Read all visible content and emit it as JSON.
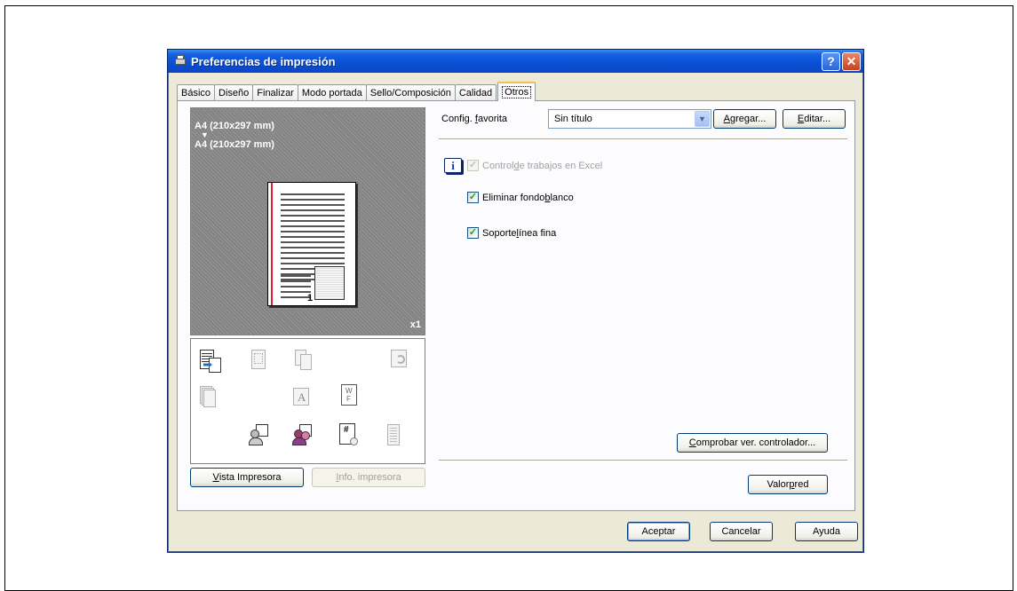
{
  "window": {
    "title": "Preferencias de impresión",
    "help_glyph": "?",
    "close_glyph": "✕"
  },
  "tabs": [
    {
      "label": "Básico"
    },
    {
      "label": "Diseño"
    },
    {
      "label": "Finalizar"
    },
    {
      "label": "Modo portada"
    },
    {
      "label": "Sello/Composición"
    },
    {
      "label": "Calidad"
    },
    {
      "label": "Otros",
      "active": true
    }
  ],
  "preview": {
    "paper_from": "A4 (210x297 mm)",
    "arrow": "▼",
    "paper_to": "A4 (210x297 mm)",
    "copies": "x1",
    "page_number": "1"
  },
  "icon_panel": {
    "icons": [
      "printer-send-icon",
      "staple-icon",
      "copy-pages-icon",
      "rotate-icon",
      "stack-icon",
      "text-a-icon",
      "watermark-wf-icon",
      "user-auth-icon",
      "account-track-icon",
      "number-icon",
      "document-list-icon"
    ]
  },
  "left_buttons": {
    "printer_view": {
      "pre": "",
      "key": "V",
      "post": "ista Impresora"
    },
    "printer_info": {
      "pre": "",
      "key": "I",
      "post": "nfo. impresora"
    }
  },
  "favorite": {
    "label_pre": "Config. ",
    "label_key": "f",
    "label_post": "avorita",
    "value": "Sin título",
    "add": {
      "pre": "",
      "key": "A",
      "post": "gregar..."
    },
    "edit": {
      "pre": "",
      "key": "E",
      "post": "ditar..."
    }
  },
  "options": {
    "excel": {
      "pre": "Control ",
      "key": "d",
      "post": "e trabajos en Excel",
      "checked": true,
      "enabled": false
    },
    "remove_white": {
      "pre": "Eliminar fondo ",
      "key": "b",
      "post": "lanco",
      "checked": true,
      "enabled": true
    },
    "thin_line": {
      "pre": "Soporte ",
      "key": "l",
      "post": "ínea fina",
      "checked": true,
      "enabled": true
    }
  },
  "info_glyph": "i",
  "check_glyph": "✓",
  "check_driver": {
    "pre": "",
    "key": "C",
    "post": "omprobar ver. controlador..."
  },
  "defaults": {
    "pre": "Valor ",
    "key": "p",
    "post": "red"
  },
  "dialog_buttons": {
    "ok": "Aceptar",
    "cancel": "Cancelar",
    "help": "Ayuda"
  }
}
